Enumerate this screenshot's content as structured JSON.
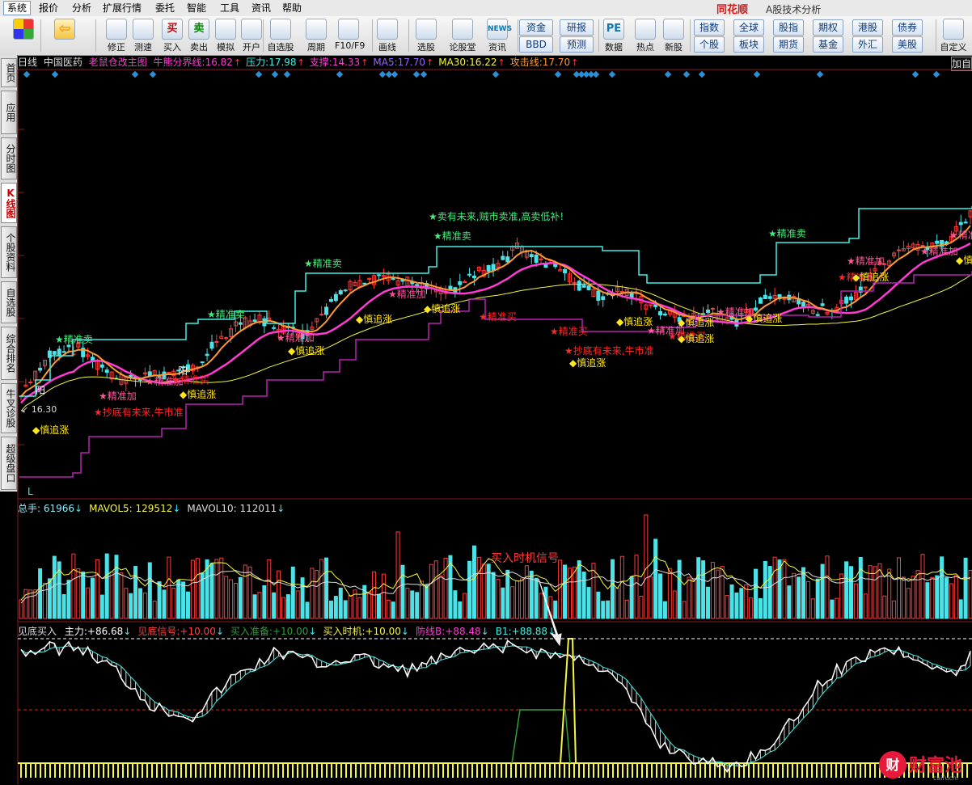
{
  "menu": {
    "items": [
      "系统",
      "报价",
      "分析",
      "扩展行情",
      "委托",
      "智能",
      "工具",
      "资讯",
      "帮助"
    ],
    "brand": "同花顺",
    "brand_sub": "A股技术分析"
  },
  "toolbar": {
    "buttons": [
      {
        "label": "",
        "icon": "four-color-icon"
      },
      {
        "label": "",
        "icon": "back-arrow-icon"
      },
      {
        "label": "修正",
        "icon": "power-icon"
      },
      {
        "label": "测速",
        "icon": "clock-icon"
      },
      {
        "label": "买入",
        "icon": "buy-icon",
        "glyph": "买"
      },
      {
        "label": "卖出",
        "icon": "sell-icon",
        "glyph": "卖"
      },
      {
        "label": "模拟",
        "icon": "hammer-icon"
      },
      {
        "label": "开户",
        "icon": "lock-icon"
      },
      {
        "label": "自选股",
        "icon": "star-icon"
      },
      {
        "label": "周期",
        "icon": "cycle-icon"
      },
      {
        "label": "F10/F9",
        "icon": "f10-icon"
      },
      {
        "label": "画线",
        "icon": "pen-icon"
      },
      {
        "label": "选股",
        "icon": "monitor-icon"
      },
      {
        "label": "论股堂",
        "icon": "forum-icon"
      },
      {
        "label": "资讯",
        "icon": "news-icon",
        "glyph": "NEWS"
      },
      {
        "label": "数据",
        "icon": "pe-icon",
        "glyph": "PE"
      },
      {
        "label": "热点",
        "icon": "hot-icon"
      },
      {
        "label": "新股",
        "icon": "new-stock-icon"
      },
      {
        "label": "自定义",
        "icon": "custom-icon"
      }
    ],
    "grid_a": [
      "资金",
      "研报",
      "BBD",
      "预测"
    ],
    "grid_b": [
      "指数",
      "全球",
      "股指",
      "期权",
      "港股",
      "债券",
      "个股",
      "板块",
      "期货",
      "基金",
      "外汇",
      "美股"
    ]
  },
  "left_tabs": [
    "首页",
    "应用",
    "分时图",
    "K线图",
    "个股资料",
    "自选股",
    "综合排名",
    "牛叉诊股",
    "超级盘口"
  ],
  "chart": {
    "period": "日线",
    "stock": "中国医药",
    "template": "老鼠仓改主图",
    "indicators": [
      {
        "label": "牛熊分界线:",
        "value": "16.82",
        "color": "#ff3bd3"
      },
      {
        "label": "压力:",
        "value": "17.98",
        "color": "#40f0e6"
      },
      {
        "label": "支撑:",
        "value": "14.33",
        "color": "#ff3bd3"
      },
      {
        "label": "MA5:",
        "value": "17.70",
        "color": "#9a62ff"
      },
      {
        "label": "MA30:",
        "value": "16.22",
        "color": "#f6f63c"
      },
      {
        "label": "攻击线:",
        "value": "17.70",
        "color": "#ff9a2e"
      }
    ],
    "add_label": "加自",
    "low_label": "16.30",
    "l_marker": "L",
    "annotations": {
      "sell_top": "★卖有未来,贼市卖准,高卖低补!",
      "jzm": "★精准卖",
      "jzj": "★精准加",
      "jzb": "★精准买",
      "zz": "◆慎追涨",
      "zz2": "◆追涨",
      "cd": "★抄底有未来,牛市准",
      "yang": "阳"
    }
  },
  "volume": {
    "labels": [
      {
        "label": "总手:",
        "value": "61966",
        "color": "#8ef"
      },
      {
        "label": "MAVOL5:",
        "value": "129512",
        "color": "#f6f63c"
      },
      {
        "label": "MAVOL10:",
        "value": "112011",
        "color": "#ddd"
      }
    ],
    "callout": "买入时机信号"
  },
  "indicator": {
    "name": "见底买入",
    "labels": [
      {
        "label": "主力:",
        "value": "+86.68",
        "color": "#ffffff"
      },
      {
        "label": "见底信号:",
        "value": "+10.00",
        "color": "#ff4040"
      },
      {
        "label": "买入准备:",
        "value": "+10.00",
        "color": "#2e9f3c"
      },
      {
        "label": "买入时机:",
        "value": "+10.00",
        "color": "#f6f63c"
      },
      {
        "label": "防线B:",
        "value": "+88.48",
        "color": "#ff3bd3"
      },
      {
        "label": "B1:",
        "value": "+88.88",
        "color": "#40f0e6"
      }
    ]
  },
  "watermark": {
    "text": "财富池",
    "url": "caifuchi"
  },
  "colors": {
    "up": "#ff3b3b",
    "down": "#4be3e8",
    "bg": "#000000"
  }
}
